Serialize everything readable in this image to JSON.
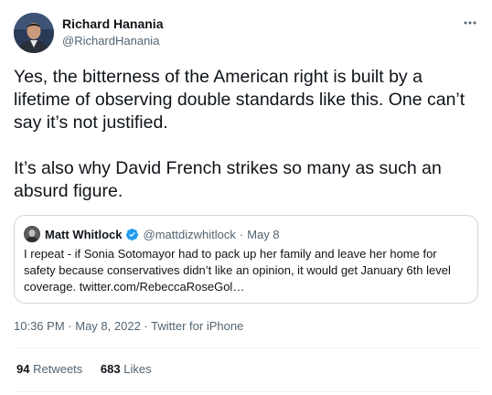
{
  "author": {
    "display_name": "Richard Hanania",
    "handle": "@RichardHanania"
  },
  "more_icon": "more-horizontal-icon",
  "tweet": {
    "text": "Yes, the bitterness of the American right is built by a lifetime of observing double standards like this. One can’t say it’s not justified.\n\nIt’s also why David French strikes so many as such an absurd figure."
  },
  "quoted_tweet": {
    "display_name": "Matt Whitlock",
    "verified_icon": "verified-badge-icon",
    "handle": "@mattdizwhitlock",
    "separator": "·",
    "date": "May 8",
    "text": "I repeat - if Sonia Sotomayor had to pack up her family and leave her home for safety because conservatives didn’t like an opinion, it would get January 6th level coverage. twitter.com/RebeccaRoseGol…"
  },
  "meta": {
    "time": "10:36 PM",
    "separator": "·",
    "date": "May 8, 2022",
    "source": "Twitter for iPhone"
  },
  "stats": {
    "retweets_count": "94",
    "retweets_label": "Retweets",
    "likes_count": "683",
    "likes_label": "Likes"
  },
  "colors": {
    "text_primary": "#0f1419",
    "text_secondary": "#536471",
    "border": "#cfd9de",
    "divider": "#eff3f4",
    "verified_blue": "#1d9bf0"
  }
}
